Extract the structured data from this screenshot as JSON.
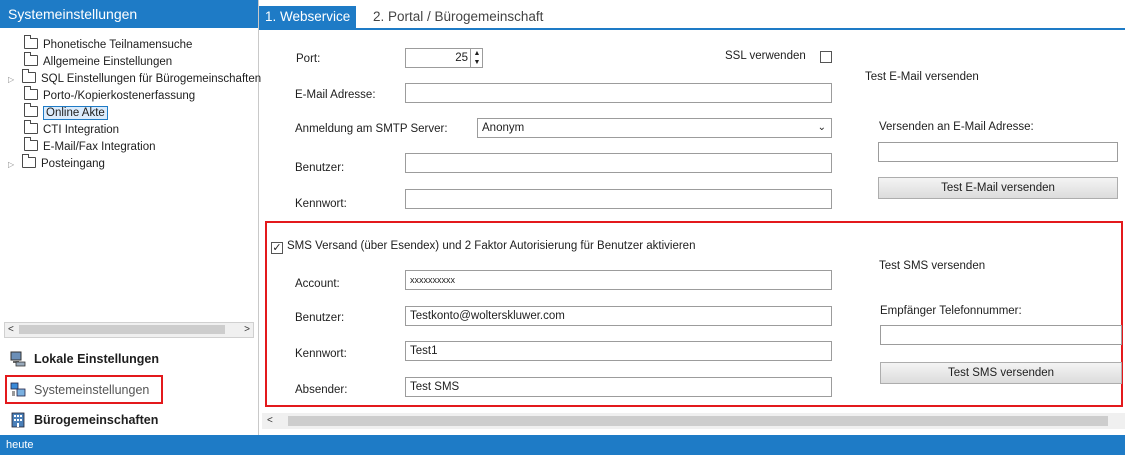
{
  "sidebar": {
    "title": "Systemeinstellungen",
    "items": [
      {
        "label": "Phonetische Teilnamensuche",
        "expandable": false
      },
      {
        "label": "Allgemeine Einstellungen",
        "expandable": false
      },
      {
        "label": "SQL Einstellungen für Bürogemeinschaften",
        "expandable": true
      },
      {
        "label": "Porto-/Kopierkostenerfassung",
        "expandable": false
      },
      {
        "label": "Online Akte",
        "expandable": false,
        "selected": true
      },
      {
        "label": "CTI Integration",
        "expandable": false
      },
      {
        "label": "E-Mail/Fax Integration",
        "expandable": false
      },
      {
        "label": "Posteingang",
        "expandable": true
      }
    ],
    "nav": {
      "local": "Lokale Einstellungen",
      "system": "Systemeinstellungen",
      "offices": "Bürogemeinschaften"
    }
  },
  "tabs": [
    {
      "label": "1. Webservice",
      "active": true
    },
    {
      "label": "2. Portal / Bürogemeinschaft",
      "active": false
    }
  ],
  "email": {
    "port_label": "Port:",
    "port_value": "25",
    "ssl_label": "SSL verwenden",
    "ssl_checked": false,
    "address_label": "E-Mail Adresse:",
    "address_value": "",
    "smtp_label": "Anmeldung am SMTP Server:",
    "smtp_value": "Anonym",
    "user_label": "Benutzer:",
    "user_value": "",
    "password_label": "Kennwort:",
    "password_value": "",
    "test_title": "Test E-Mail versenden",
    "test_recipient_label": "Versenden an E-Mail Adresse:",
    "test_recipient_value": "",
    "test_button": "Test E-Mail versenden"
  },
  "sms": {
    "enable_label": "SMS Versand (über Esendex) und 2 Faktor Autorisierung für Benutzer aktivieren",
    "enabled": true,
    "account_label": "Account:",
    "account_value": "xxxxxxxxxx",
    "user_label": "Benutzer:",
    "user_value": "Testkonto@wolterskluwer.com",
    "password_label": "Kennwort:",
    "password_value": "Test1",
    "sender_label": "Absender:",
    "sender_value": "Test SMS",
    "test_title": "Test SMS versenden",
    "test_phone_label": "Empfänger Telefonnummer:",
    "test_phone_value": "",
    "test_button": "Test SMS versenden"
  },
  "status": {
    "text": "heute"
  },
  "colors": {
    "accent": "#1e7bc6",
    "highlight": "#e3191c"
  }
}
